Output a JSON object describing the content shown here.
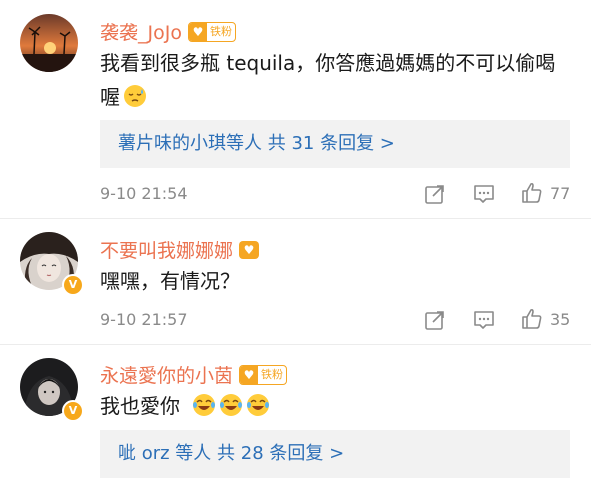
{
  "comments": [
    {
      "username": "袭袭_JoJo",
      "fan_badge": "铁粉",
      "text": "我看到很多瓶 tequila，你答應過媽媽的不可以偷喝喔",
      "emoji": "sleepy-sweat-emoji",
      "reply_summary": "薯片味的小琪等人 共 31 条回复 >",
      "timestamp": "9-10 21:54",
      "like_count": "77"
    },
    {
      "username": "不要叫我娜娜娜",
      "verified": true,
      "text": "嘿嘿，有情况？",
      "timestamp": "9-10 21:57",
      "like_count": "35"
    },
    {
      "username": "永遠愛你的小茵",
      "fan_badge": "铁粉",
      "verified": true,
      "text": "我也愛你",
      "emoji": "laugh-cry-emoji",
      "reply_summary": "呲 orz 等人 共 28 条回复 >"
    }
  ],
  "colors": {
    "username": "#eb7350",
    "reply_link": "#2c6fb7",
    "badge": "#f5a623",
    "meta": "#8a8a8a"
  }
}
